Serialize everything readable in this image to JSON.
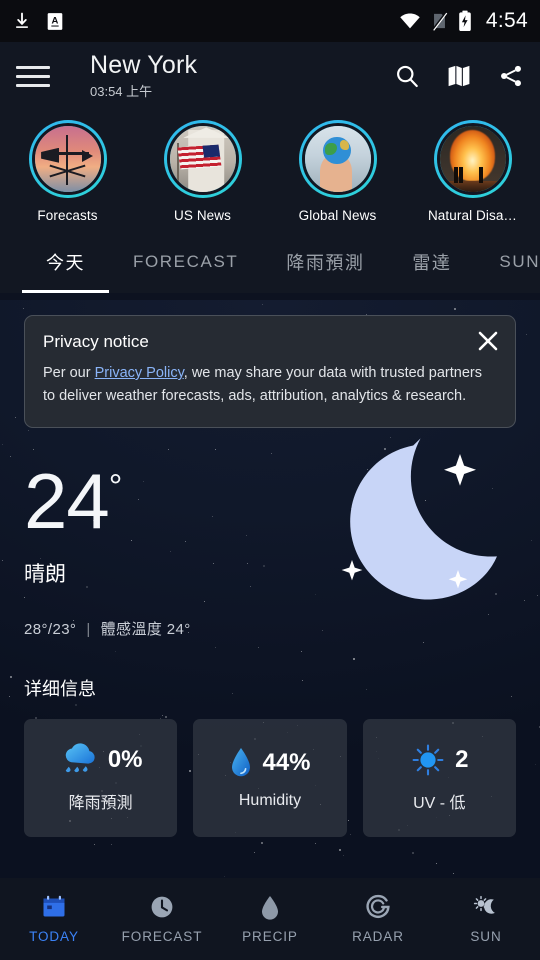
{
  "status_bar": {
    "time": "4:54",
    "left_icons": [
      "download-icon",
      "keyboard-indicator-icon"
    ],
    "right_icons": [
      "wifi-icon",
      "no-sim-icon",
      "battery-charging-icon"
    ]
  },
  "app_bar": {
    "menu_icon": "hamburger-menu-icon",
    "city": "New York",
    "local_time": "03:54 上午",
    "actions": [
      {
        "name": "search-icon",
        "label": "Search"
      },
      {
        "name": "map-icon",
        "label": "Map"
      },
      {
        "name": "share-icon",
        "label": "Share"
      }
    ]
  },
  "stories": [
    {
      "label": "Forecasts",
      "art": "weather-vane-sunset"
    },
    {
      "label": "US News",
      "art": "us-flag-building"
    },
    {
      "label": "Global News",
      "art": "hand-holding-globe"
    },
    {
      "label": "Natural Disa…",
      "art": "wildfire-blaze"
    }
  ],
  "tabs": [
    {
      "label": "今天",
      "active": true,
      "cjk": true
    },
    {
      "label": "FORECAST",
      "active": false,
      "cjk": false
    },
    {
      "label": "降雨預測",
      "active": false,
      "cjk": true
    },
    {
      "label": "雷達",
      "active": false,
      "cjk": true
    },
    {
      "label": "SUN",
      "active": false,
      "cjk": false
    }
  ],
  "privacy_notice": {
    "title": "Privacy notice",
    "body_before_link": "Per our ",
    "link_text": "Privacy Policy",
    "body_after_link": ", we may share your data with trusted partners to deliver weather forecasts, ads, attribution, analytics & research.",
    "close_icon": "close-icon"
  },
  "current": {
    "temperature": "24",
    "degree_symbol": "°",
    "condition": "晴朗",
    "high_low": "28°/23°",
    "separator": "|",
    "feels_like": "體感溫度  24°",
    "weather_icon": "crescent-moon-stars-icon"
  },
  "details": {
    "heading": "详细信息",
    "cards": [
      {
        "icon": "rain-cloud-icon",
        "value": "0%",
        "label": "降雨預測",
        "color": "#2f9fe8"
      },
      {
        "icon": "water-drop-icon",
        "value": "44%",
        "label": "Humidity",
        "color": "#2f8fe0"
      },
      {
        "icon": "sun-icon",
        "value": "2",
        "label": "UV - 低",
        "color": "#2196f3"
      }
    ]
  },
  "bottom_nav": [
    {
      "label": "TODAY",
      "icon": "calendar-icon",
      "active": true
    },
    {
      "label": "FORECAST",
      "icon": "clock-icon",
      "active": false
    },
    {
      "label": "PRECIP",
      "icon": "droplet-icon",
      "active": false
    },
    {
      "label": "RADAR",
      "icon": "radar-icon",
      "active": false
    },
    {
      "label": "SUN",
      "icon": "moon-sun-icon",
      "active": false
    }
  ],
  "colors": {
    "accent_blue": "#3b82f6",
    "ring_cyan": "#31b7ef",
    "link_blue": "#8ab4f8",
    "background": "#0d1220",
    "chrome": "#121722"
  }
}
